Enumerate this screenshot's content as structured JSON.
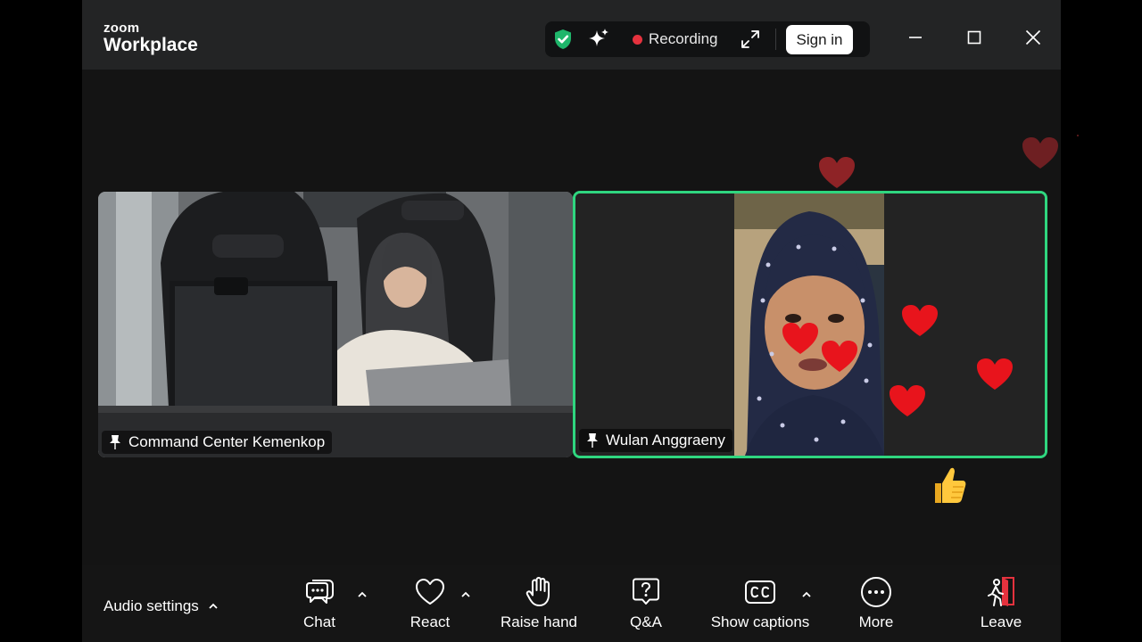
{
  "app": {
    "brand_top": "zoom",
    "brand_bottom": "Workplace"
  },
  "statusbar": {
    "recording_label": "Recording",
    "sign_in_label": "Sign in",
    "shield_color": "#1fb66b",
    "recording_color": "#e5323e"
  },
  "participants": [
    {
      "name": "Command Center Kemenkop",
      "active_speaker": false
    },
    {
      "name": "Wulan Anggraeny",
      "active_speaker": true
    }
  ],
  "active_speaker_border": "#2fd67f",
  "reactions": {
    "hearts": 8,
    "thumbs_up": 1
  },
  "toolbar": {
    "audio_settings_label": "Audio settings",
    "chat_label": "Chat",
    "react_label": "React",
    "raise_hand_label": "Raise hand",
    "qa_label": "Q&A",
    "show_captions_label": "Show captions",
    "more_label": "More",
    "leave_label": "Leave",
    "leave_accent": "#e5323e"
  },
  "icons": [
    "shield-check-icon",
    "sparkle-icon",
    "expand-icon",
    "minimize-icon",
    "maximize-icon",
    "close-icon",
    "chat-icon",
    "heart-icon",
    "hand-icon",
    "question-icon",
    "cc-icon",
    "more-dots-icon",
    "leave-icon",
    "chevron-up-icon",
    "pin-icon"
  ]
}
